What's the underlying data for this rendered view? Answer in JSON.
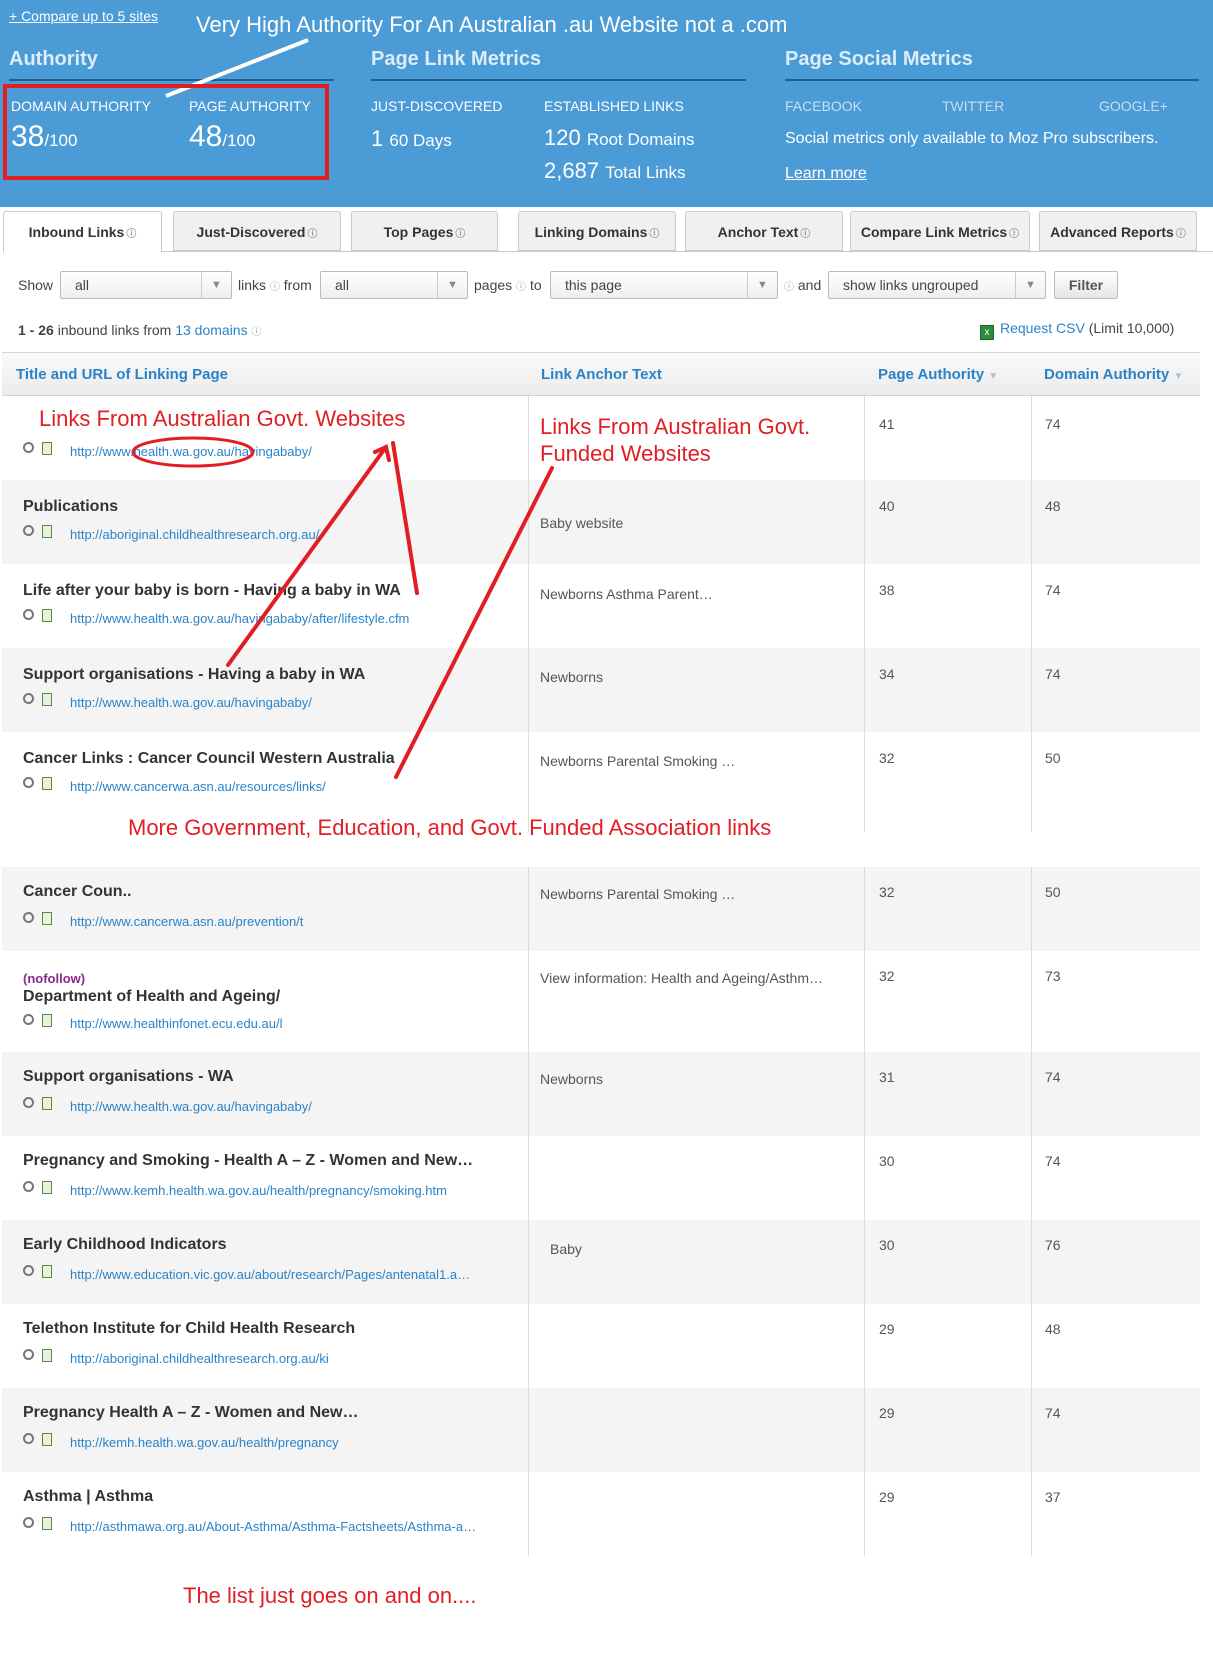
{
  "header": {
    "compare_link": "+ Compare up to 5 sites",
    "authority": {
      "title": "Authority",
      "domain_label": "DOMAIN AUTHORITY",
      "domain_value": "38",
      "domain_suffix": "/100",
      "page_label": "PAGE AUTHORITY",
      "page_value": "48",
      "page_suffix": "/100"
    },
    "link_metrics": {
      "title": "Page Link Metrics",
      "just_discovered_label": "JUST-DISCOVERED",
      "just_discovered_value": "1",
      "just_discovered_suffix": "60 Days",
      "established_label": "ESTABLISHED LINKS",
      "root_domains_value": "120",
      "root_domains_suffix": "Root Domains",
      "total_links_value": "2,687",
      "total_links_suffix": "Total Links"
    },
    "social": {
      "title": "Page Social Metrics",
      "facebook": "FACEBOOK",
      "twitter": "TWITTER",
      "google": "GOOGLE+",
      "note": "Social metrics only available to Moz Pro subscribers.",
      "learn_more": "Learn more"
    }
  },
  "tabs": [
    {
      "label": "Inbound Links"
    },
    {
      "label": "Just-Discovered"
    },
    {
      "label": "Top Pages"
    },
    {
      "label": "Linking Domains"
    },
    {
      "label": "Anchor Text"
    },
    {
      "label": "Compare Link Metrics"
    },
    {
      "label": "Advanced Reports"
    }
  ],
  "filters": {
    "show_label": "Show",
    "show_value": "all",
    "links_label": "links",
    "from_label": "from",
    "from_value": "all",
    "pages_label": "pages",
    "to_label": "to",
    "to_value": "this page",
    "and_label": "and",
    "group_value": "show links ungrouped",
    "filter_button": "Filter"
  },
  "results": {
    "range": "1 - 26",
    "text": "inbound links from",
    "domains_link": "13 domains",
    "csv_link": "Request CSV",
    "csv_limit": "(Limit 10,000)"
  },
  "table": {
    "headers": {
      "title_url": "Title and URL of Linking Page",
      "anchor": "Link Anchor Text",
      "page_authority": "Page Authority",
      "domain_authority": "Domain Authority"
    },
    "rows_top": [
      {
        "title": "",
        "url": "http://www.health.wa.gov.au/havingababy/",
        "anchor": "",
        "pa": "41",
        "da": "74"
      },
      {
        "title": "Publications",
        "url": "http://aboriginal.childhealthresearch.org.au/",
        "anchor": "Baby website",
        "pa": "40",
        "da": "48"
      },
      {
        "title": "Life after your baby is born - Having a baby in WA",
        "url": "http://www.health.wa.gov.au/havingababy/after/lifestyle.cfm",
        "anchor": "Newborns Asthma Parent…",
        "pa": "38",
        "da": "74"
      },
      {
        "title": "Support organisations - Having a baby in WA",
        "url": "http://www.health.wa.gov.au/havingababy/",
        "anchor": "Newborns",
        "pa": "34",
        "da": "74"
      },
      {
        "title": "Cancer Links : Cancer Council Western Australia",
        "url": "http://www.cancerwa.asn.au/resources/links/",
        "anchor": "Newborns Parental Smoking …",
        "pa": "32",
        "da": "50"
      }
    ],
    "rows_bottom": [
      {
        "title": "Cancer Coun..",
        "url": "http://www.cancerwa.asn.au/prevention/t",
        "anchor": "Newborns Parental Smoking …",
        "pa": "32",
        "da": "50"
      },
      {
        "title": "Department of Health and Ageing/",
        "nofollow": "(nofollow)",
        "url": "http://www.healthinfonet.ecu.edu.au/l",
        "anchor": "View information: Health and Ageing/Asthm…",
        "pa": "32",
        "da": "73"
      },
      {
        "title": "Support organisations - WA",
        "url": "http://www.health.wa.gov.au/havingababy/",
        "anchor": "Newborns",
        "pa": "31",
        "da": "74"
      },
      {
        "title": "Pregnancy and Smoking - Health A – Z - Women and New…",
        "url": "http://www.kemh.health.wa.gov.au/health/pregnancy/smoking.htm",
        "anchor": "",
        "pa": "30",
        "da": "74"
      },
      {
        "title": "Early Childhood Indicators",
        "url": "http://www.education.vic.gov.au/about/research/Pages/antenatal1.a…",
        "anchor": "Baby",
        "pa": "30",
        "da": "76"
      },
      {
        "title": "Telethon Institute for Child Health Research",
        "url": "http://aboriginal.childhealthresearch.org.au/ki",
        "anchor": "",
        "pa": "29",
        "da": "48"
      },
      {
        "title": "Pregnancy Health A – Z - Women and New…",
        "url": "http://kemh.health.wa.gov.au/health/pregnancy",
        "anchor": "",
        "pa": "29",
        "da": "74"
      },
      {
        "title": "Asthma | Asthma",
        "url": "http://asthmawa.org.au/About-Asthma/Asthma-Factsheets/Asthma-a…",
        "anchor": "",
        "pa": "29",
        "da": "37"
      }
    ]
  },
  "annotations": {
    "top_white": "Very High Authority For An Australian .au Website not a .com",
    "govt_sites": "Links From Australian Govt. Websites",
    "funded_sites": "Links From Australian Govt. Funded Websites",
    "more_links": "More Government, Education, and Govt. Funded Association links",
    "goes_on": "The list just goes on and on....",
    "accent_red": "#e01e24"
  },
  "colors": {
    "header_bg": "#4a9bd6",
    "link_blue": "#2a83c8"
  }
}
